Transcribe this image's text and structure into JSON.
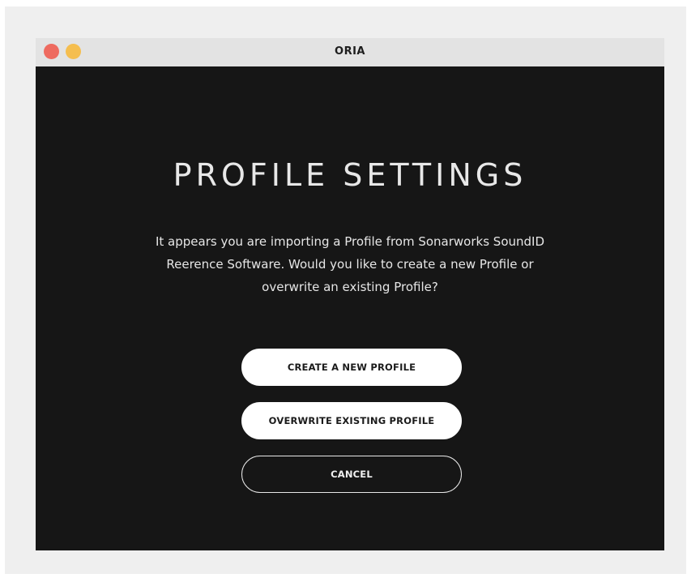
{
  "window": {
    "title": "ORIA",
    "controls": [
      {
        "name": "close-dot",
        "color": "#ee6a5f"
      },
      {
        "name": "minimize-dot",
        "color": "#f5be4f"
      }
    ]
  },
  "dialog": {
    "heading": "PROFILE SETTINGS",
    "message_lines": [
      "It appears you are importing a Profile from Sonarworks SoundID",
      "Reerence Software. Would you like to create a new Profile or",
      "overwrite an existing Profile?"
    ],
    "buttons": {
      "create": "CREATE A NEW PROFILE",
      "overwrite": "OVERWRITE EXISTING PROFILE",
      "cancel": "CANCEL"
    }
  },
  "colors": {
    "background": "#161616",
    "titlebar": "#e3e3e3",
    "text": "#e8e8e8",
    "button_fill": "#ffffff"
  }
}
